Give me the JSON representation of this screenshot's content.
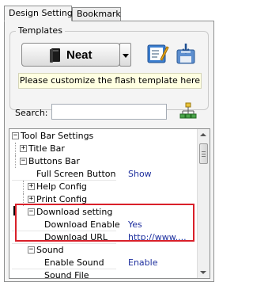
{
  "tabs": [
    {
      "label": "Design Setting",
      "active": true
    },
    {
      "label": "Bookmark",
      "active": false
    }
  ],
  "templates": {
    "group_title": "Templates",
    "selected_template": "Neat",
    "hint": "Please customize the flash template here",
    "icons": [
      "edit-template-icon",
      "save-template-icon"
    ]
  },
  "search": {
    "label": "Search:",
    "value": "",
    "icon": "search-tree-icon"
  },
  "tree": {
    "rows": [
      {
        "label": "Tool Bar Settings",
        "expander": "minus",
        "value": ""
      },
      {
        "label": "Title Bar",
        "expander": "plus",
        "value": ""
      },
      {
        "label": "Buttons Bar",
        "expander": "minus",
        "value": ""
      },
      {
        "label": "Full Screen Button",
        "expander": "",
        "value": "Show"
      },
      {
        "label": "Help Config",
        "expander": "plus",
        "value": ""
      },
      {
        "label": "Print Config",
        "expander": "plus",
        "value": ""
      },
      {
        "label": "Download setting",
        "expander": "minus",
        "value": ""
      },
      {
        "label": "Download Enable",
        "expander": "",
        "value": "Yes"
      },
      {
        "label": "Download URL",
        "expander": "",
        "value": "http://www...."
      },
      {
        "label": "Sound",
        "expander": "minus",
        "value": ""
      },
      {
        "label": "Enable Sound",
        "expander": "",
        "value": "Enable"
      },
      {
        "label": "Sound File",
        "expander": "",
        "value": ""
      }
    ]
  },
  "colors": {
    "highlight_box": "#d9202a",
    "value_text": "#1e2f9e",
    "hint_background": "#ffffe1"
  }
}
